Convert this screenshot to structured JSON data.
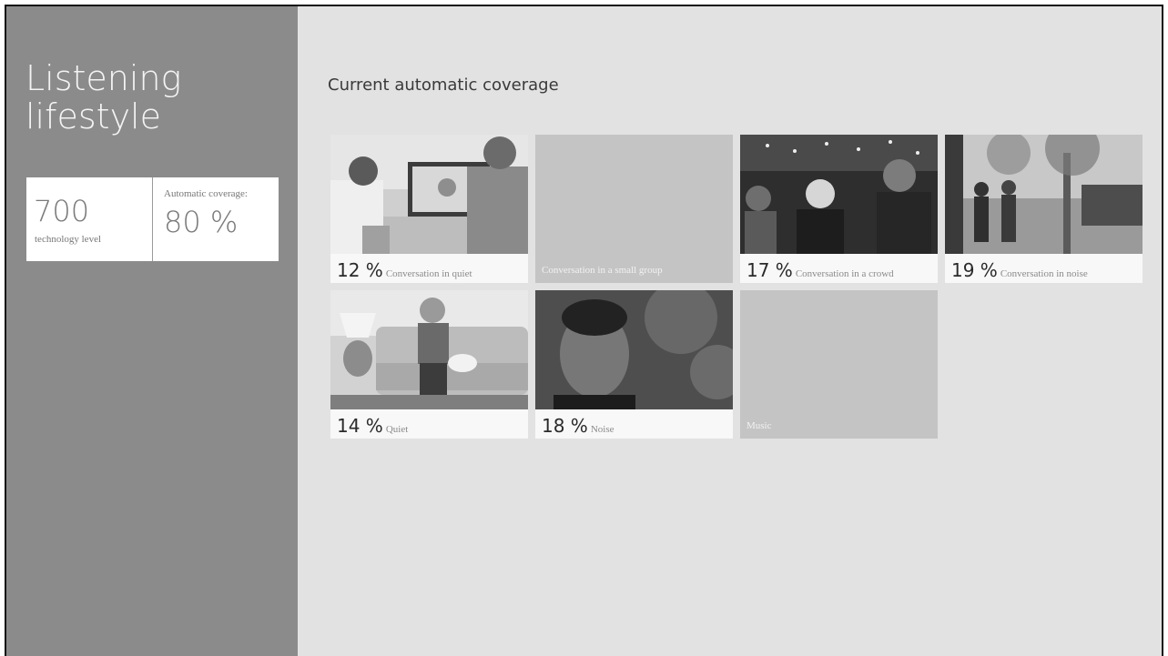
{
  "sidebar": {
    "title_line1": "Listening",
    "title_line2": "lifestyle",
    "technology_value": "700",
    "technology_label": "technology level",
    "coverage_label": "Automatic coverage:",
    "coverage_value": "80 %"
  },
  "main": {
    "heading": "Current automatic coverage",
    "tiles": [
      {
        "percent": "12 %",
        "label": "Conversation in quiet",
        "has_photo": true
      },
      {
        "percent": "",
        "label": "Conversation in a small group",
        "has_photo": false
      },
      {
        "percent": "17 %",
        "label": "Conversation in a crowd",
        "has_photo": true
      },
      {
        "percent": "19 %",
        "label": "Conversation in noise",
        "has_photo": true
      },
      {
        "percent": "14 %",
        "label": "Quiet",
        "has_photo": true
      },
      {
        "percent": "18 %",
        "label": "Noise",
        "has_photo": true
      },
      {
        "percent": "",
        "label": "Music",
        "has_photo": false
      }
    ]
  }
}
